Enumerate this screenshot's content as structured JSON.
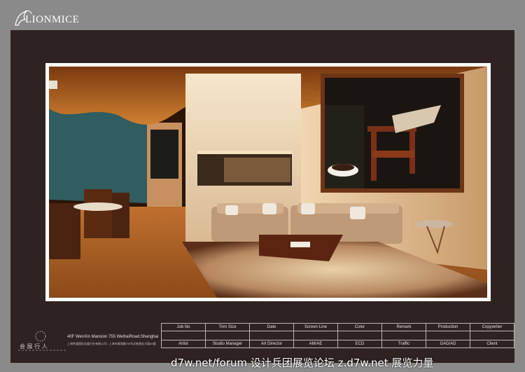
{
  "brand": {
    "name": "LIONMICE"
  },
  "company": {
    "logo_text": "会 展 行 人",
    "address_en": "40F WenXin Mansion 755 WeihaiRoad,Shanghai",
    "address_cn": "上海朴盛国际会展行社有限公司 • 上海市威海路755号文新报业大厦40楼"
  },
  "spec_table": {
    "row1": [
      "Job No",
      "Trim Size",
      "Date",
      "Screen Line",
      "Color",
      "Remark",
      "Production",
      "Copywriter"
    ],
    "row3": [
      "Artist",
      "Studio Manager",
      "Art Director",
      "AM/AE",
      "ECD",
      "Traffic",
      "GAD/AD",
      "Client"
    ]
  },
  "watermark": "d7w.net/forum 设计兵团展览论坛   z.d7w.net 展览力量",
  "colors": {
    "background": "#8a8a8a",
    "panel": "#2e2321",
    "ceiling": "#b4641e",
    "walls": "#d9b48a"
  }
}
